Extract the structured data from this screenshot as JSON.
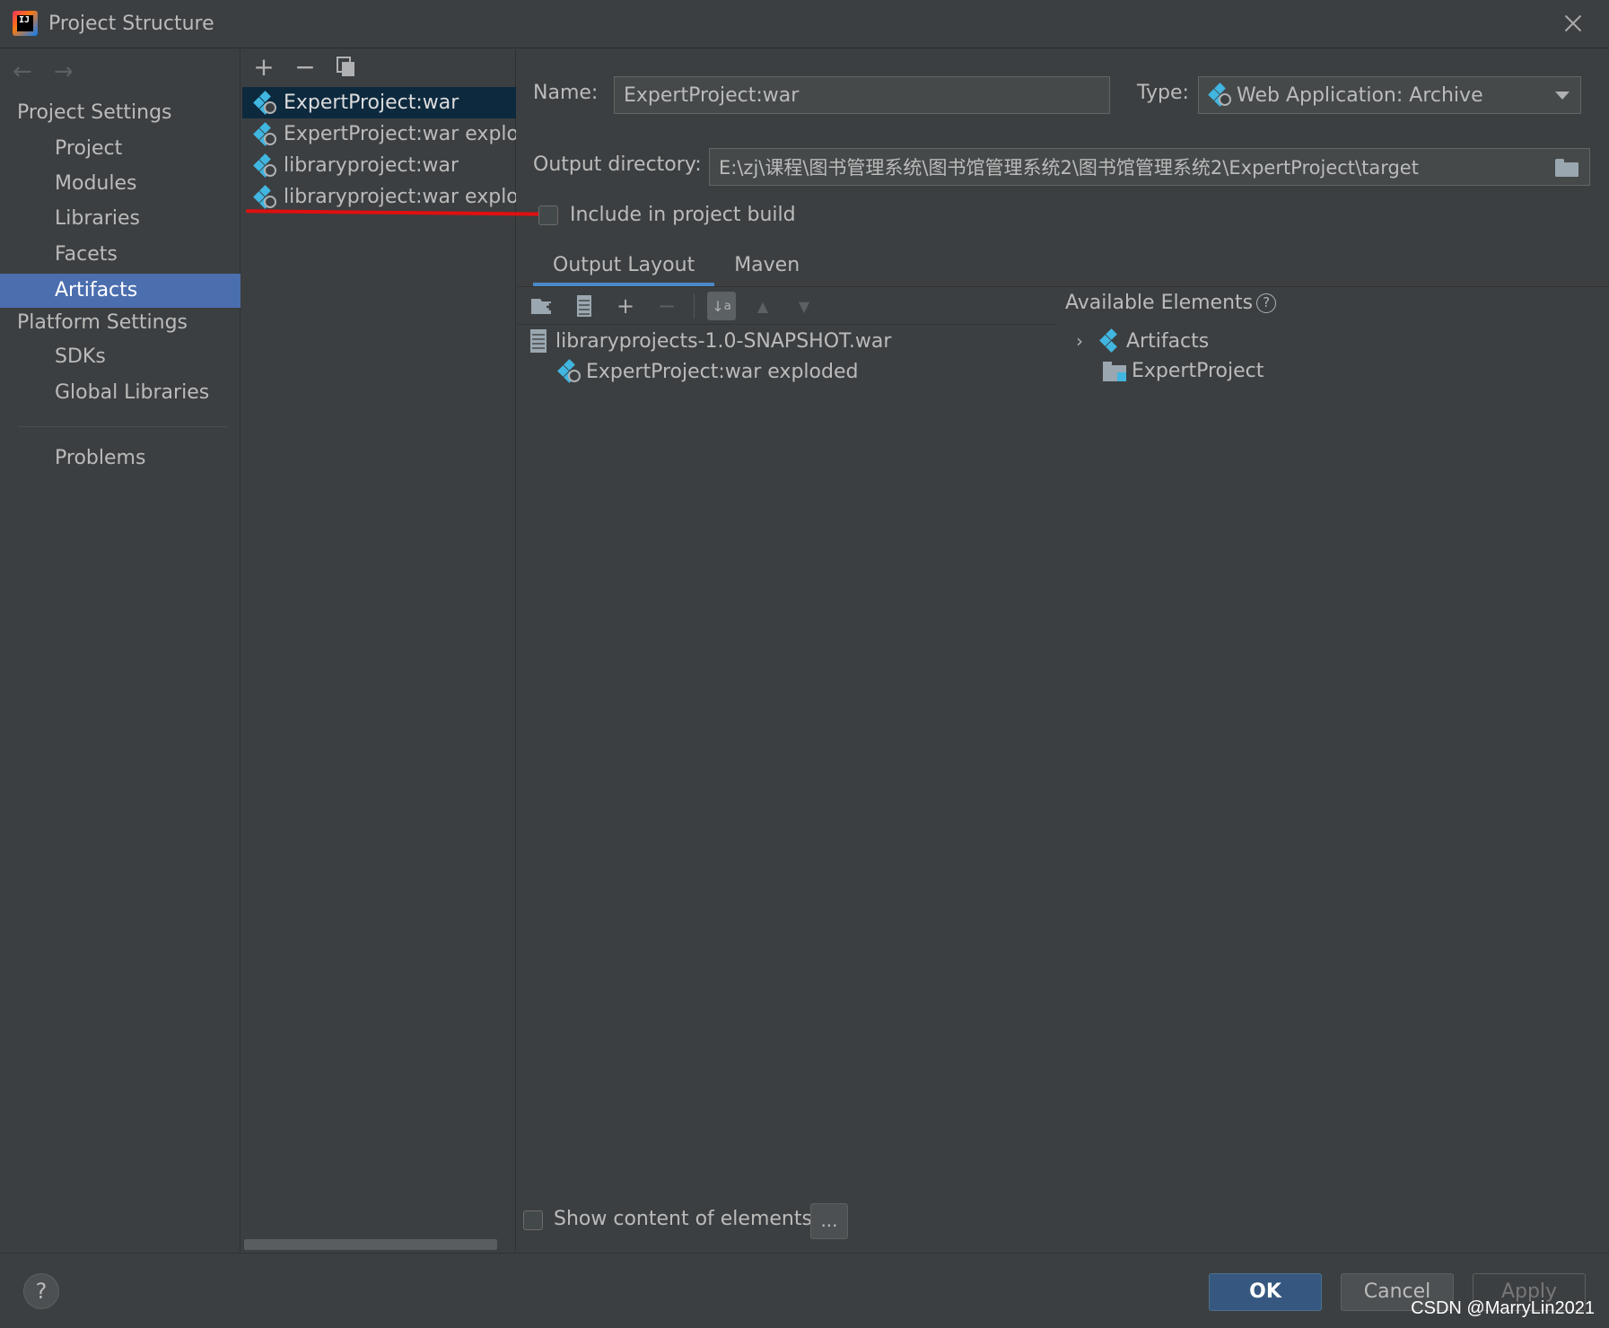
{
  "window": {
    "title": "Project Structure"
  },
  "nav": {
    "project_settings_header": "Project Settings",
    "project_items": [
      "Project",
      "Modules",
      "Libraries",
      "Facets",
      "Artifacts"
    ],
    "selected": "Artifacts",
    "platform_settings_header": "Platform Settings",
    "platform_items": [
      "SDKs",
      "Global Libraries"
    ],
    "problems": "Problems"
  },
  "artifacts": {
    "toolbar": [
      "add-icon",
      "remove-icon",
      "copy-icon"
    ],
    "items": [
      {
        "label": "ExpertProject:war",
        "selected": true
      },
      {
        "label": "ExpertProject:war explode"
      },
      {
        "label": "libraryproject:war"
      },
      {
        "label": "libraryproject:war explode"
      }
    ]
  },
  "details": {
    "name_label": "Name:",
    "name_value": "ExpertProject:war",
    "type_label": "Type:",
    "type_value": "Web Application: Archive",
    "output_label": "Output directory:",
    "output_value": "E:\\zj\\课程\\图书管理系统\\图书馆管理系统2\\图书馆管理系统2\\ExpertProject\\target",
    "include_label": "Include in project build",
    "include_checked": false,
    "tabs": [
      {
        "label": "Output Layout",
        "active": true
      },
      {
        "label": "Maven"
      }
    ],
    "layout_tree": [
      {
        "label": "libraryprojects-1.0-SNAPSHOT.war",
        "icon": "archive-icon"
      },
      {
        "label": "ExpertProject:war exploded",
        "icon": "web-artifact-icon"
      }
    ],
    "available_label": "Available Elements",
    "available_tree": [
      {
        "label": "Artifacts",
        "icon": "artifacts-icon"
      },
      {
        "label": "ExpertProject",
        "icon": "module-folder-icon"
      }
    ],
    "show_content_label": "Show content of elements",
    "dots_label": "..."
  },
  "buttons": {
    "help": "?",
    "ok": "OK",
    "cancel": "Cancel",
    "apply": "Apply"
  },
  "watermark": "CSDN @MarryLin2021",
  "colors": {
    "background": "#3c3f41",
    "selection": "#4b6eaf",
    "list_selection": "#0d293e",
    "accent": "#365880",
    "annotation": "#e01010"
  }
}
